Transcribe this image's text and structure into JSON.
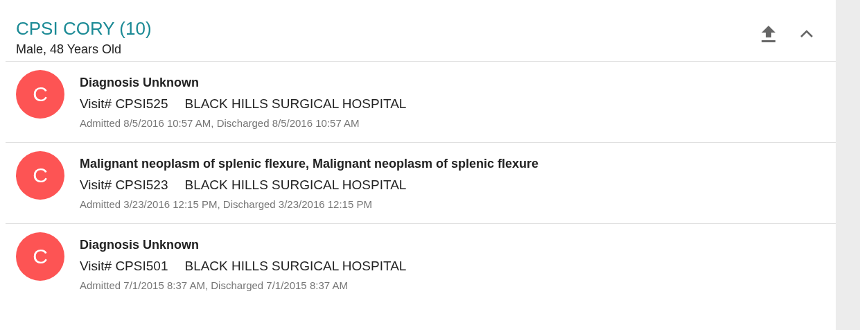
{
  "patient": {
    "name": "CPSI CORY (10)",
    "details": "Male, 48 Years Old"
  },
  "visits": [
    {
      "avatar": "C",
      "diagnosis": "Diagnosis Unknown",
      "visit": "Visit# CPSI525",
      "facility": "BLACK HILLS SURGICAL HOSPITAL",
      "dates": "Admitted 8/5/2016 10:57 AM, Discharged 8/5/2016 10:57 AM"
    },
    {
      "avatar": "C",
      "diagnosis": "Malignant neoplasm of splenic flexure, Malignant neoplasm of splenic flexure",
      "visit": "Visit# CPSI523",
      "facility": "BLACK HILLS SURGICAL HOSPITAL",
      "dates": "Admitted 3/23/2016 12:15 PM, Discharged 3/23/2016 12:15 PM"
    },
    {
      "avatar": "C",
      "diagnosis": "Diagnosis Unknown",
      "visit": "Visit# CPSI501",
      "facility": "BLACK HILLS SURGICAL HOSPITAL",
      "dates": "Admitted 7/1/2015 8:37 AM, Discharged 7/1/2015 8:37 AM"
    }
  ]
}
